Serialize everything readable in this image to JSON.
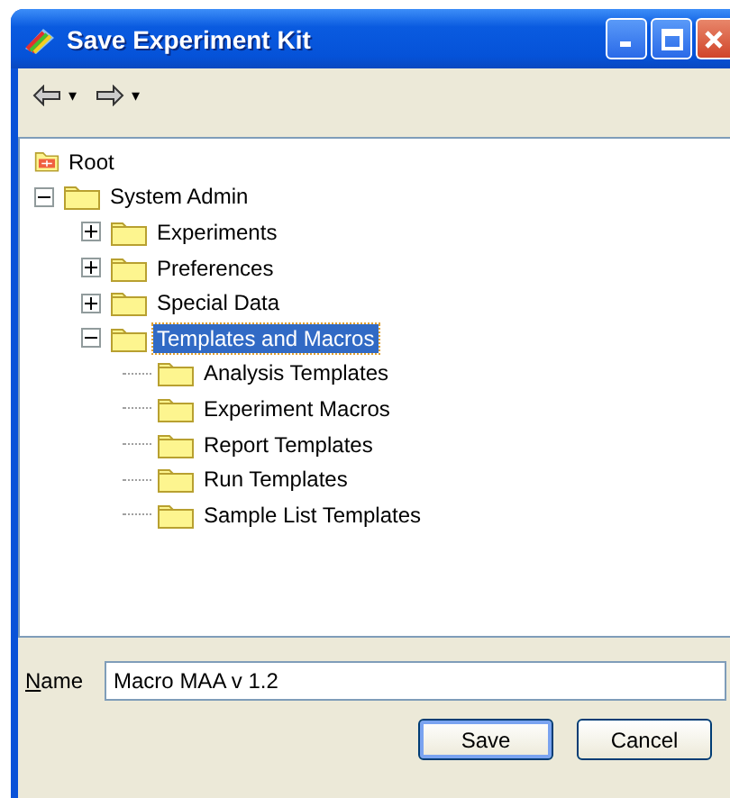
{
  "window": {
    "title": "Save Experiment Kit"
  },
  "toolbar": {
    "back_menu": "▾",
    "forward_menu": "▾"
  },
  "tree": [
    {
      "label": "Root",
      "kind": "root",
      "selected": false
    },
    {
      "label": "System Admin",
      "kind": "folder",
      "expanded": true,
      "selected": false,
      "children": [
        {
          "label": "Experiments",
          "kind": "folder",
          "expanded": false,
          "selected": false
        },
        {
          "label": "Preferences",
          "kind": "folder",
          "expanded": false,
          "selected": false
        },
        {
          "label": "Special Data",
          "kind": "folder",
          "expanded": false,
          "selected": false
        },
        {
          "label": "Templates and Macros",
          "kind": "folder",
          "expanded": true,
          "selected": true,
          "children": [
            {
              "label": "Analysis Templates",
              "kind": "folder",
              "selected": false
            },
            {
              "label": "Experiment Macros",
              "kind": "folder",
              "selected": false
            },
            {
              "label": "Report Templates",
              "kind": "folder",
              "selected": false
            },
            {
              "label": "Run Templates",
              "kind": "folder",
              "selected": false
            },
            {
              "label": "Sample List Templates",
              "kind": "folder",
              "selected": false
            }
          ]
        }
      ]
    }
  ],
  "name_field": {
    "label": "Name",
    "value": "Macro MAA v 1.2"
  },
  "buttons": [
    "Save",
    "Cancel"
  ]
}
